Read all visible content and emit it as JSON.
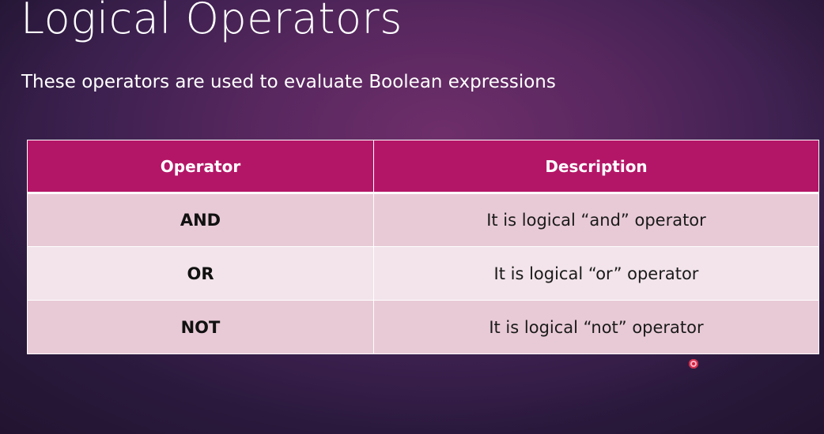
{
  "slide": {
    "title": "Logical Operators",
    "subtitle": "These operators are used to evaluate Boolean expressions"
  },
  "table": {
    "headers": [
      "Operator",
      "Description"
    ],
    "rows": [
      {
        "operator": "AND",
        "description": "It is logical “and” operator"
      },
      {
        "operator": "OR",
        "description": "It is logical “or” operator"
      },
      {
        "operator": "NOT",
        "description": "It is logical “not” operator"
      }
    ]
  },
  "colors": {
    "header_bg": "#b41667",
    "row_odd_bg": "#e8cad6",
    "row_even_bg": "#f2e4ea",
    "background": "#5a2860"
  }
}
